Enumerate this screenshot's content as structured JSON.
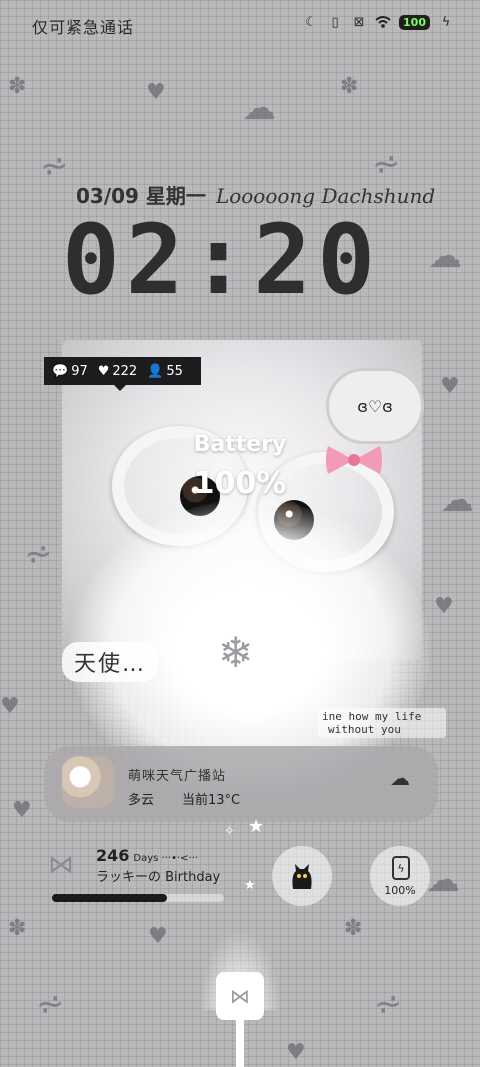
{
  "status_bar": {
    "left_text": "仅可紧急通话",
    "battery_level": "100"
  },
  "date": {
    "text": "03/09  星期一",
    "script": "Looooong Dachshund"
  },
  "clock": {
    "time": "02:20"
  },
  "stats": {
    "comments": "97",
    "likes": "222",
    "followers": "55"
  },
  "battery": {
    "title": "Battery",
    "value": "100%"
  },
  "thought_bubble": {
    "text": "ɞ♡ɞ"
  },
  "angel_text": "天使…",
  "quote": {
    "line1": "ine how my life",
    "line2": "without you"
  },
  "weather": {
    "station": "萌咪天气广播站",
    "condition": "多云",
    "temperature": "当前13°C"
  },
  "countdown": {
    "days": "246",
    "days_label": "Days ···•·<···",
    "birthday": "ラッキーの Birthday",
    "progress": 0.67
  },
  "battery_widget": {
    "label": "100%"
  }
}
